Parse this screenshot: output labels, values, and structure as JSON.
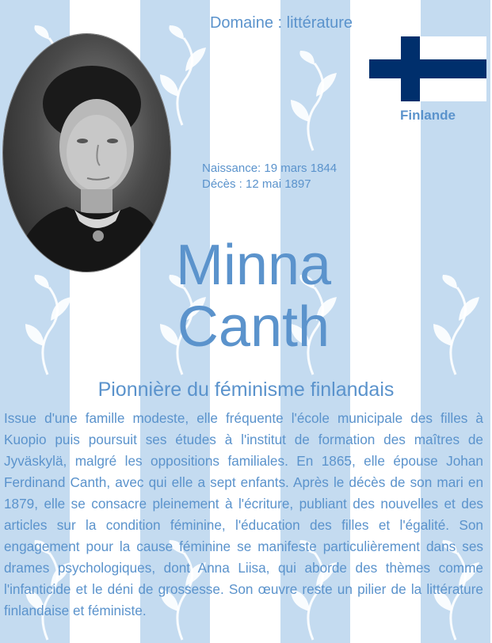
{
  "domain": "Domaine : littérature",
  "country": "Finlande",
  "flag_icon": "finland-flag",
  "colors": {
    "accent": "#5b93cc",
    "stripe": "#c4dbf0",
    "flag_blue": "#002f6c",
    "flag_white": "#ffffff"
  },
  "birth": "Naissance: 19 mars 1844",
  "death": "Décès : 12 mai 1897",
  "name_first": "Minna",
  "name_last": "Canth",
  "subtitle": "Pionnière du féminisme finlandais",
  "bio": "Issue d'une famille modeste, elle fréquente l'école municipale des filles à Kuopio puis poursuit ses études à l'institut de formation des maîtres de Jyväskylä, malgré les oppositions familiales. En 1865, elle épouse Johan Ferdinand Canth, avec qui elle a sept enfants. Après le décès de son mari en 1879, elle se consacre pleinement à l'écriture, publiant des nouvelles et des articles sur la condition féminine, l'éducation des filles et l'égalité. Son engagement pour la cause féminine se manifeste particulièrement dans ses drames psychologiques, dont Anna Liisa, qui aborde des thèmes comme l'infanticide et le déni de grossesse. Son œuvre reste un pilier de la littérature finlandaise et féministe."
}
